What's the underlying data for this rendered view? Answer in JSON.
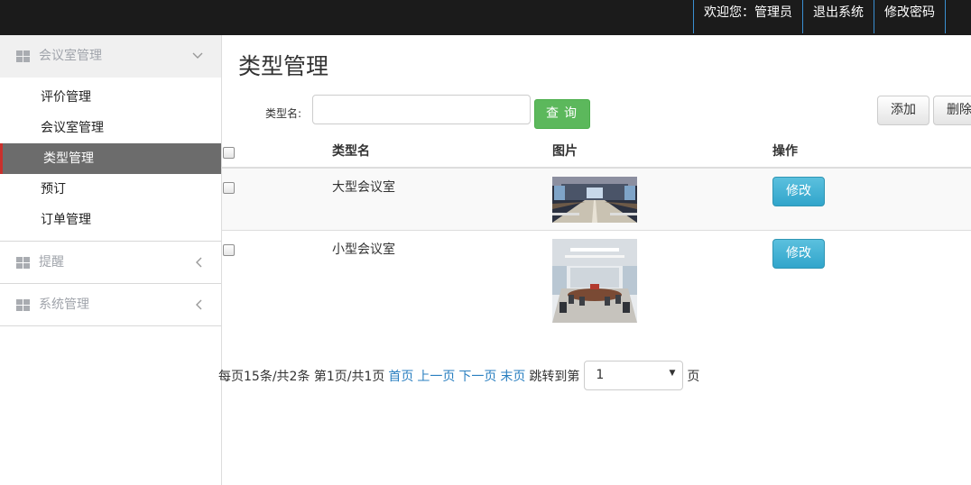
{
  "topnav": {
    "welcome": "欢迎您：管理员",
    "logout": "退出系统",
    "change_password": "修改密码"
  },
  "sidebar": {
    "groups": [
      {
        "label": "会议室管理",
        "chevron": "chevron-down-icon",
        "icon": "grid-icon",
        "items": [
          {
            "label": "评价管理"
          },
          {
            "label": "会议室管理"
          },
          {
            "label": "类型管理",
            "active": true
          },
          {
            "label": "预订"
          },
          {
            "label": "订单管理"
          }
        ]
      },
      {
        "label": "提醒",
        "chevron": "chevron-left-icon",
        "icon": "grid-icon"
      },
      {
        "label": "系统管理",
        "chevron": "chevron-left-icon",
        "icon": "grid-icon"
      }
    ]
  },
  "main": {
    "title": "类型管理",
    "search": {
      "label": "类型名:",
      "value": "",
      "button": "查询"
    },
    "add_button": "添加",
    "delete_button": "删除",
    "table": {
      "headers": [
        "类型名",
        "图片",
        "操作"
      ],
      "rows": [
        {
          "name": "大型会议室",
          "image": "large-meeting-room-photo",
          "action": "修改"
        },
        {
          "name": "小型会议室",
          "image": "small-meeting-room-photo",
          "action": "修改"
        }
      ]
    },
    "pager": {
      "summary": "每页15条/共2条 第1页/共1页",
      "first": "首页",
      "prev": "上一页",
      "next": "下一页",
      "last": "末页",
      "jump_label": "跳转到第",
      "page_value": "1",
      "page_suffix": "页"
    }
  },
  "colors": {
    "topbar": "#1b1b1b",
    "search_button": "#5cb85c",
    "edit_button": "#5bc0de",
    "active_nav": "#6c6c6c",
    "link": "#2a7fc0"
  }
}
